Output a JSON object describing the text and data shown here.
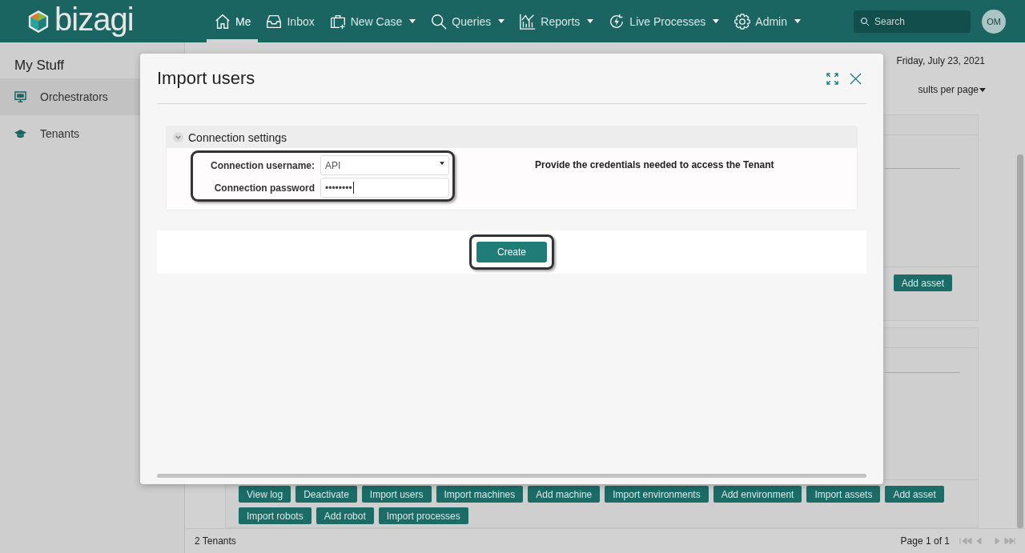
{
  "header": {
    "logo": "bizagi",
    "nav": [
      {
        "label": "Me",
        "selected": true,
        "dropdown": false
      },
      {
        "label": "Inbox",
        "selected": false,
        "dropdown": false
      },
      {
        "label": "New Case",
        "selected": false,
        "dropdown": true
      },
      {
        "label": "Queries",
        "selected": false,
        "dropdown": true
      },
      {
        "label": "Reports",
        "selected": false,
        "dropdown": true
      },
      {
        "label": "Live Processes",
        "selected": false,
        "dropdown": true
      },
      {
        "label": "Admin",
        "selected": false,
        "dropdown": true
      }
    ],
    "search": {
      "placeholder": "Search"
    },
    "avatar": "OM"
  },
  "sidebar": {
    "title": "My Stuff",
    "items": [
      {
        "label": "Orchestrators",
        "selected": true
      },
      {
        "label": "Tenants",
        "selected": false
      }
    ]
  },
  "main": {
    "date": "Friday, July 23, 2021",
    "results_per_page": "sults per page",
    "cards": [
      {
        "buttons": [
          "Add asset"
        ]
      },
      {
        "buttons": [
          "View log",
          "Deactivate",
          "Import users",
          "Import machines",
          "Add machine",
          "Import environments",
          "Add environment",
          "Import assets",
          "Add asset",
          "Import robots",
          "Add robot",
          "Import processes"
        ]
      }
    ]
  },
  "footer": {
    "count": "2 Tenants",
    "page": "Page 1 of 1"
  },
  "dialog": {
    "title": "Import users",
    "section": {
      "title": "Connection settings",
      "expanded": true,
      "fields": [
        {
          "label": "Connection username:",
          "kind": "select",
          "value": "API"
        },
        {
          "label": "Connection password",
          "kind": "password",
          "value": "••••••••"
        }
      ],
      "help": "Provide the credentials needed to access the Tenant"
    },
    "button": "Create"
  }
}
